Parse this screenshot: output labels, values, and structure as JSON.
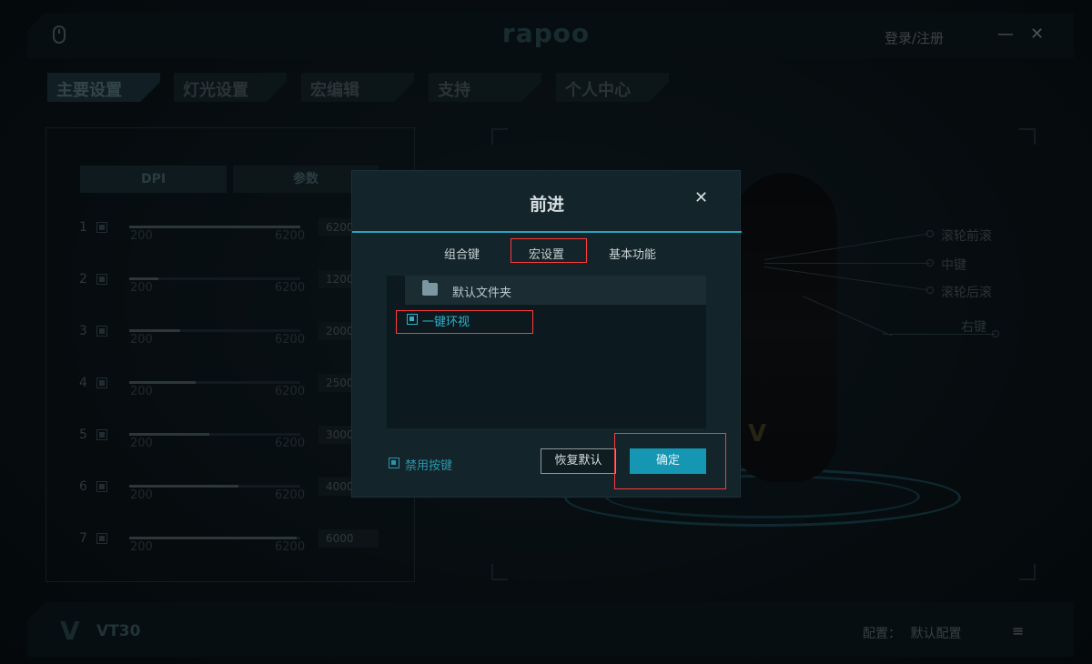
{
  "app": {
    "brand": "rapoo",
    "login": "登录/注册",
    "minimize": "—",
    "close": "✕"
  },
  "tabs": [
    "主要设置",
    "灯光设置",
    "宏编辑",
    "支持",
    "个人中心"
  ],
  "left_panel": {
    "subtabs": [
      "DPI",
      "参数"
    ],
    "dpi_min_label": "200",
    "dpi_max_label": "6200",
    "rows": [
      {
        "num": "1",
        "value": "6200",
        "level": 1.0
      },
      {
        "num": "2",
        "value": "1200",
        "level": 0.17
      },
      {
        "num": "3",
        "value": "2000",
        "level": 0.3
      },
      {
        "num": "4",
        "value": "2500",
        "level": 0.39
      },
      {
        "num": "5",
        "value": "3000",
        "level": 0.47
      },
      {
        "num": "6",
        "value": "4000",
        "level": 0.64
      },
      {
        "num": "7",
        "value": "6000",
        "level": 0.98
      }
    ]
  },
  "mouse_labels": {
    "scroll_forward": "滚轮前滚",
    "middle": "中键",
    "scroll_back": "滚轮后滚",
    "right": "右键",
    "logo": "V"
  },
  "footer": {
    "logo": "V",
    "model": "VT30",
    "config_label": "配置：",
    "config_value": "默认配置",
    "menu_icon": "≡"
  },
  "modal": {
    "title": "前进",
    "close": "✕",
    "tabs": [
      "组合键",
      "宏设置",
      "基本功能"
    ],
    "active_tab": "宏设置",
    "folder": "默认文件夹",
    "items": [
      "一键环视"
    ],
    "disable_label": "禁用按键",
    "restore_button": "恢复默认",
    "confirm_button": "确定"
  },
  "colors": {
    "accent": "#1597b3",
    "highlight_box": "#ff3b3b",
    "modal_bg": "#13242a"
  }
}
